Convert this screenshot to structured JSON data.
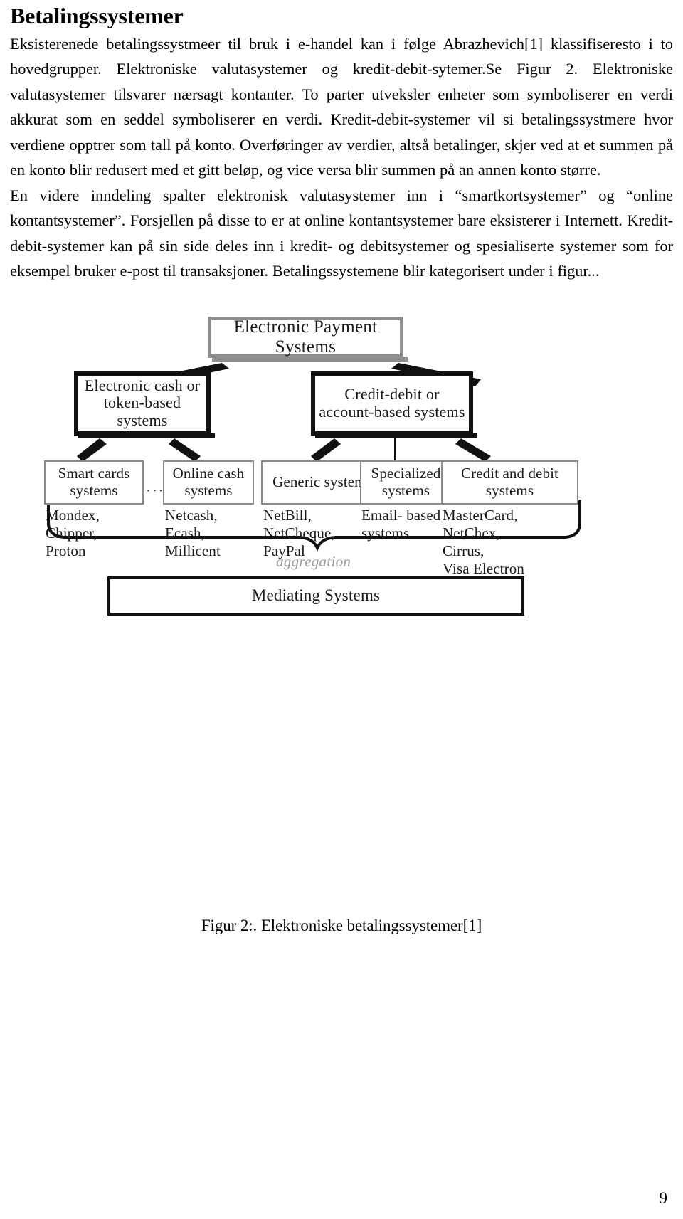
{
  "document": {
    "heading": "Betalingssystemer",
    "paragraphs": [
      "Eksisterenede betalingssystmeer til bruk i e-handel kan i følge Abrazhevich[1] klassifiseresto i to hovedgrupper. Elektroniske valutasystemer og kredit-debit-sytemer.Se Figur 2. Elektroniske valutasystemer tilsvarer nærsagt kontanter. To parter utveksler enheter som symboliserer en verdi akkurat  som en seddel symboliserer en verdi. Kredit-debit-systemer vil si betalingssystmere hvor verdiene opptrer som tall på konto. Overføringer av verdier, altså betalinger, skjer ved at et summen på en konto blir redusert med et gitt beløp, og vice versa blir summen på an annen konto større.",
      "En videre inndeling spalter elektronisk valutasystemer inn i “smartkortsystemer” og “online kontantsystemer”. Forsjellen på disse to er at online kontantsystemer bare eksisterer i Internett. Kredit-debit-systemer kan på sin side deles inn i kredit- og debitsystemer og spesialiserte systemer som for eksempel bruker e-post til transaksjoner. Betalingssystemene blir kategorisert under i figur..."
    ],
    "figure_caption": "Figur 2:. Elektroniske betalingssystemer[1]",
    "page_number": "9"
  },
  "figure": {
    "root": "Electronic Payment Systems",
    "level2": [
      "Electronic cash or\ntoken-based systems",
      "Credit-debit or\naccount-based systems"
    ],
    "level3": [
      "Smart cards\nsystems",
      "Online cash\nsystems",
      "Generic systems",
      "Specialized\nsystems",
      "Credit and debit\nsystems"
    ],
    "examples": [
      "Mondex,\nChipper,\nProton",
      "Netcash,\nEcash,\nMillicent",
      "NetBill,\nNetCheque,\nPayPal",
      "Email- based\nsystems",
      "MasterCard,\nNetChex,\nCirrus,\nVisa Electron"
    ],
    "ellipsis": "⋅⋅⋅",
    "aggregation_label": "aggregation",
    "mediating": "Mediating Systems"
  }
}
